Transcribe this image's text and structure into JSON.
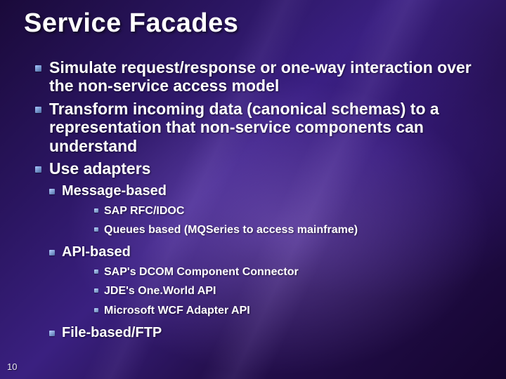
{
  "title": "Service Facades",
  "bullets": [
    "Simulate request/response or one-way interaction over the non-service access model",
    "Transform incoming data (canonical schemas) to a representation that non-service components can understand",
    "Use adapters"
  ],
  "adapters": [
    {
      "label": "Message-based",
      "items": [
        "SAP RFC/IDOC",
        "Queues based (MQSeries to access mainframe)"
      ]
    },
    {
      "label": "API-based",
      "items": [
        "SAP's DCOM Component Connector",
        "JDE's One.World API",
        "Microsoft WCF Adapter API"
      ]
    },
    {
      "label": "File-based/FTP",
      "items": []
    }
  ],
  "page_number": "10"
}
